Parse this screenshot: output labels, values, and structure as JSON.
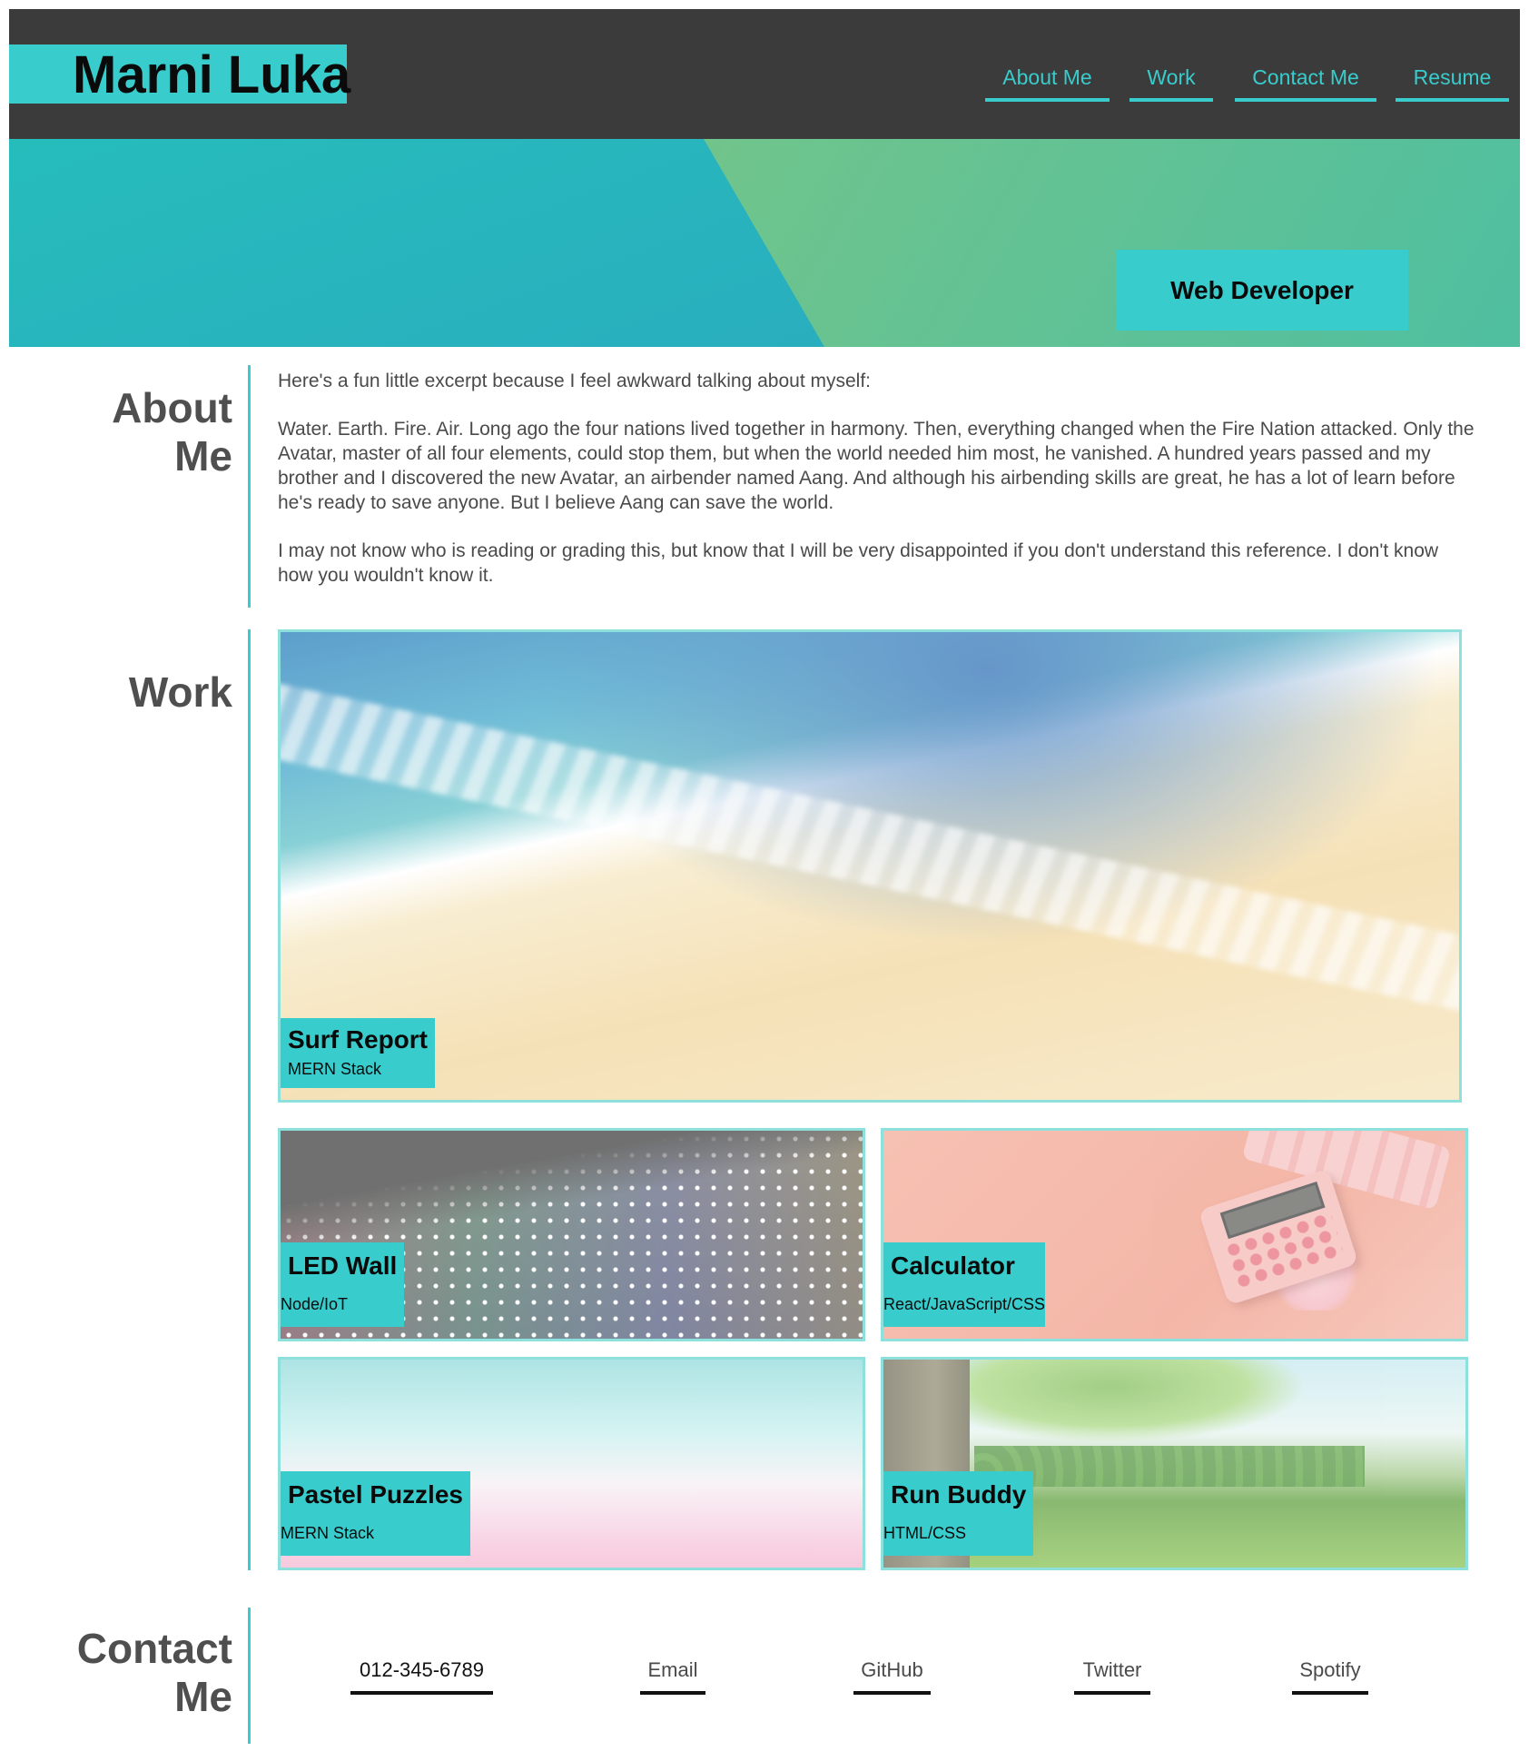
{
  "header": {
    "brand": "Marni Luka",
    "nav": [
      {
        "label": "About Me"
      },
      {
        "label": "Work"
      },
      {
        "label": "Contact Me"
      },
      {
        "label": "Resume"
      }
    ]
  },
  "hero": {
    "badge": "Web Developer"
  },
  "about": {
    "title_line1": "About",
    "title_line2": "Me",
    "paragraphs": [
      "Here's a fun little excerpt because I feel awkward talking about myself:",
      "Water. Earth. Fire. Air. Long ago the four nations lived together in harmony. Then, everything changed when the Fire Nation attacked. Only the Avatar, master of all four elements, could stop them, but when the world needed him most, he vanished. A hundred years passed and my brother and I discovered the new Avatar, an airbender named Aang. And although his airbending skills are great, he has a lot of learn before he's ready to save anyone. But I believe Aang can save the world.",
      "I may not know who is reading or grading this, but know that I will be very disappointed if you don't understand this reference. I don't know how you wouldn't know it."
    ]
  },
  "work": {
    "title": "Work",
    "projects": [
      {
        "title": "Surf Report",
        "stack": "MERN Stack",
        "image": "beach-image"
      },
      {
        "title": "LED Wall",
        "stack": "Node/IoT",
        "image": "led-image"
      },
      {
        "title": "Calculator",
        "stack": "React/JavaScript/CSS",
        "image": "calculator-image"
      },
      {
        "title": "Pastel Puzzles",
        "stack": "MERN Stack",
        "image": "pastel-image"
      },
      {
        "title": "Run Buddy",
        "stack": "HTML/CSS",
        "image": "landscape-image"
      }
    ]
  },
  "contact": {
    "title_line1": "Contact",
    "title_line2": "Me",
    "links": [
      {
        "label": "012-345-6789"
      },
      {
        "label": "Email"
      },
      {
        "label": "GitHub"
      },
      {
        "label": "Twitter"
      },
      {
        "label": "Spotify"
      }
    ]
  },
  "colors": {
    "accent": "#39cccc",
    "header_bg": "#3b3b3b",
    "text": "#4a4a4a"
  }
}
